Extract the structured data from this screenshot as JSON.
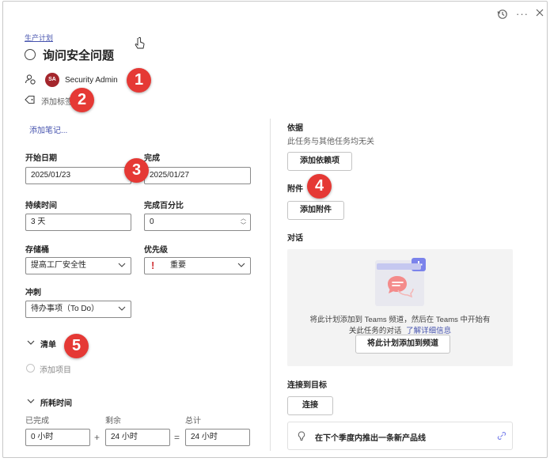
{
  "header": {
    "breadcrumb": "生产计划",
    "title": "询问安全问题"
  },
  "assignee": {
    "initials": "SA",
    "name": "Security Admin"
  },
  "labels": {
    "add_label": "添加标签"
  },
  "notes": {
    "add_notes": "添加笔记..."
  },
  "fields": {
    "start_date": {
      "label": "开始日期",
      "value": "2025/01/23"
    },
    "due_date": {
      "label": "完成",
      "value": "2025/01/27"
    },
    "duration": {
      "label": "持续时间",
      "value": "3 天"
    },
    "percent": {
      "label": "完成百分比",
      "value": "0"
    },
    "bucket": {
      "label": "存储桶",
      "value": "提高工厂安全性"
    },
    "priority": {
      "label": "优先级",
      "value": "重要"
    },
    "sprint": {
      "label": "冲刺",
      "value": "待办事项（To Do）"
    }
  },
  "checklist": {
    "title": "清单",
    "add_item": "添加项目"
  },
  "effort": {
    "title": "所耗时间",
    "completed": {
      "label": "已完成",
      "value": "0 小时"
    },
    "remaining": {
      "label": "剩余",
      "value": "24 小时"
    },
    "total": {
      "label": "总计",
      "value": "24 小时"
    },
    "plus": "+",
    "equals": "="
  },
  "dependencies": {
    "title": "依据",
    "empty": "此任务与其他任务均无关",
    "add_button": "添加依赖项"
  },
  "attachments": {
    "title": "附件",
    "add_button": "添加附件"
  },
  "conversation": {
    "title": "对话",
    "message_line1": "将此计划添加到 Teams 频道，然后在 Teams 中开始有",
    "message_line2": "关此任务的对话",
    "learn_more": "了解详细信息",
    "add_button": "将此计划添加到频道"
  },
  "goals": {
    "title": "连接到目标",
    "connect_button": "连接",
    "goal_text": "在下个季度内推出一条新产品线"
  },
  "callouts": [
    "1",
    "2",
    "3",
    "4",
    "5"
  ],
  "colors": {
    "accent": "#4653ae",
    "callout": "#e53935",
    "priority": "#d13438"
  }
}
